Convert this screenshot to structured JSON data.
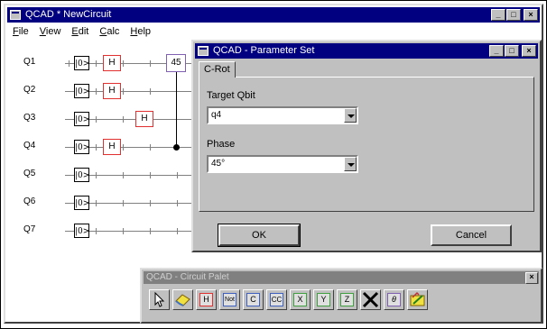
{
  "main_window": {
    "title": "QCAD * NewCircuit",
    "menu": [
      "File",
      "View",
      "Edit",
      "Calc",
      "Help"
    ],
    "min_label": "_",
    "max_label": "□",
    "close_label": "×"
  },
  "circuit": {
    "qubits": [
      "Q1",
      "Q2",
      "Q3",
      "Q4",
      "Q5",
      "Q6",
      "Q7"
    ],
    "ket_label": "|0>",
    "h_label": "H",
    "rotation_label": "45"
  },
  "dialog": {
    "title": "QCAD - Parameter Set",
    "tab": "C-Rot",
    "target_label": "Target Qbit",
    "target_value": "q4",
    "phase_label": "Phase",
    "phase_value": "45°",
    "ok_label": "OK",
    "cancel_label": "Cancel",
    "min_label": "_",
    "max_label": "□",
    "close_label": "×"
  },
  "palette": {
    "title": "QCAD - Circuit Palet",
    "close_label": "×",
    "tools": [
      {
        "name": "pointer-icon",
        "label": ""
      },
      {
        "name": "eraser-icon",
        "label": ""
      },
      {
        "name": "hadamard-tool",
        "label": "H"
      },
      {
        "name": "not-tool",
        "label": "Not"
      },
      {
        "name": "c-not-tool",
        "label": "C"
      },
      {
        "name": "cc-not-tool",
        "label": "CC"
      },
      {
        "name": "x-gate-tool",
        "label": "X"
      },
      {
        "name": "y-gate-tool",
        "label": "Y"
      },
      {
        "name": "z-gate-tool",
        "label": "Z"
      },
      {
        "name": "delete-icon",
        "label": ""
      },
      {
        "name": "rotation-tool",
        "label": "θ"
      },
      {
        "name": "measure-icon",
        "label": ""
      }
    ]
  },
  "colors": {
    "title_bar": "#000080",
    "gate_h": "#e03030",
    "gate_rot": "#8060b0"
  }
}
